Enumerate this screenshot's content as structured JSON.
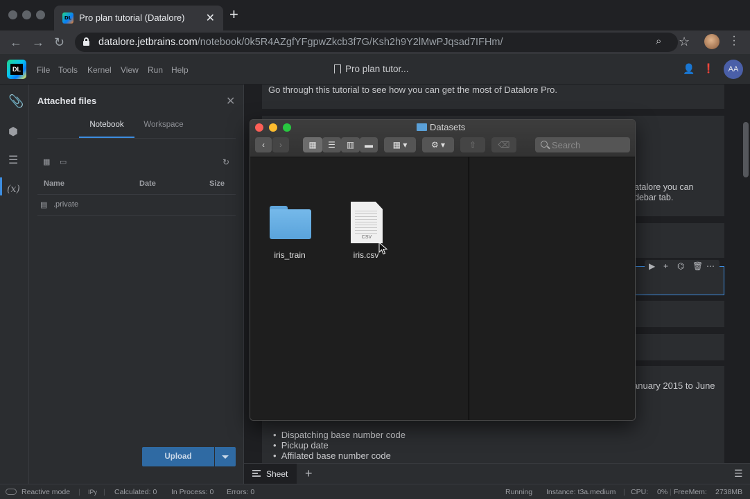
{
  "browser": {
    "tab_title": "Pro plan tutorial (Datalore)",
    "favicon_text": "DL",
    "url_host": "datalore.jetbrains.com",
    "url_path": "/notebook/0k5R4AZgfYFgpwZkcb3f7G/Ksh2h9Y2lMwPJqsad7IFHm/"
  },
  "app": {
    "logo_text": "DL",
    "menu": [
      "File",
      "Tools",
      "Kernel",
      "View",
      "Run",
      "Help"
    ],
    "notebook_title": "Pro plan tutor...",
    "user_initials": "AA"
  },
  "rail": {
    "icons": [
      "paperclip-icon",
      "cube-icon",
      "list-icon",
      "variables-icon"
    ],
    "variables_glyph": "(x)"
  },
  "files_panel": {
    "title": "Attached files",
    "tabs": [
      "Notebook",
      "Workspace"
    ],
    "columns": [
      "Name",
      "Date",
      "Size"
    ],
    "files": [
      {
        "name": ".private"
      }
    ],
    "upload_label": "Upload"
  },
  "notebook": {
    "intro_text": "Go through this tutorial to see how you can get the most of Datalore Pro.",
    "partial_text_1": "atalore you can",
    "partial_text_2": "debar tab.",
    "partial_text_3": "anuary 2015 to June",
    "bullets": [
      "Dispatching base number code",
      "Pickup date",
      "Affilated base number code"
    ]
  },
  "sheets": {
    "tabs": [
      "Sheet"
    ]
  },
  "statusbar": {
    "reactive_mode": "Reactive mode",
    "kernel": "IPy",
    "calculated": "Calculated: 0",
    "in_process": "In Process: 0",
    "errors": "Errors: 0",
    "state": "Running",
    "instance": "Instance: t3a.medium",
    "cpu_label": "CPU:",
    "cpu_value": "0%",
    "freemem_label": "FreeMem:",
    "freemem_value": "2738MB"
  },
  "finder": {
    "title": "Datasets",
    "search_placeholder": "Search",
    "items": [
      {
        "name": "iris_train",
        "kind": "folder"
      },
      {
        "name": "iris.csv",
        "kind": "csv",
        "badge": "CSV"
      }
    ]
  },
  "colors": {
    "accent": "#3d8de0",
    "upload": "#2f6aa3",
    "folder": "#5aa3db",
    "close": "#fc5f57",
    "minimize": "#fdbc2e",
    "zoom": "#28c840"
  }
}
